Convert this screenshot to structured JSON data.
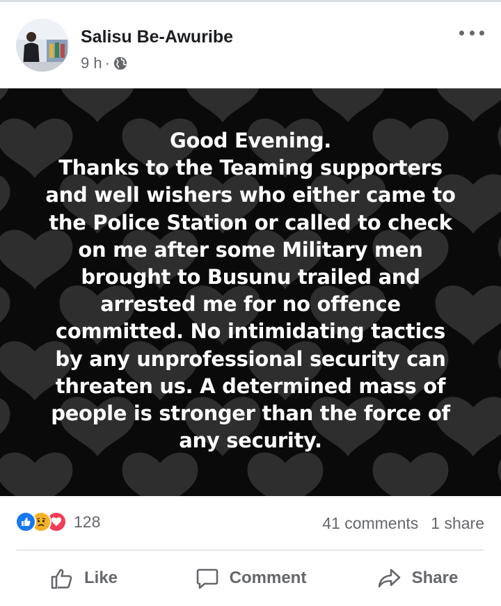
{
  "post": {
    "author": "Salisu Be-Awuribe",
    "time": "9 h",
    "separator": "·",
    "privacy_icon": "globe-icon",
    "menu_icon": "more-options-icon",
    "image_text": "Good Evening.\nThanks to the Teaming supporters\nand well wishers who either came to\nthe Police Station or called to check\non me after  some  Military men\nbrought to Busunu trailed and\narrested me for  no offence\ncommitted. No intimidating tactics\nby any unprofessional security can\nthreaten us. A determined mass of\npeople is stronger than the force of\nany security."
  },
  "reactions": {
    "icons": [
      "like-reaction-icon",
      "sad-reaction-icon",
      "love-reaction-icon"
    ],
    "count": "128",
    "comments": "41 comments",
    "shares": "1 share"
  },
  "actions": {
    "like_label": "Like",
    "comment_label": "Comment",
    "share_label": "Share"
  },
  "colors": {
    "facebook_blue": "#1877f2",
    "sad_yellow": "#f7b125",
    "love_red": "#f33e58",
    "secondary_text": "#65676b",
    "image_background": "#0a0a0a",
    "heart_gray": "#2e2e2e"
  }
}
